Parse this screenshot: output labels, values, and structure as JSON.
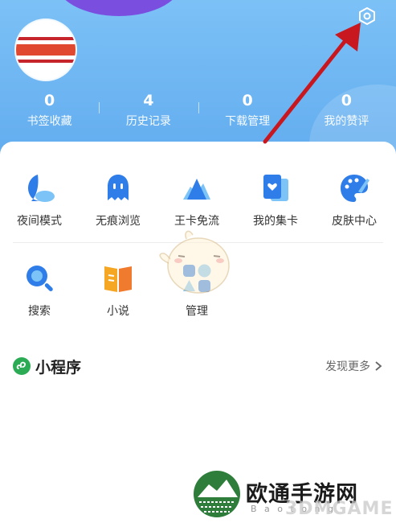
{
  "stats": [
    {
      "value": "0",
      "label": "书签收藏"
    },
    {
      "value": "4",
      "label": "历史记录"
    },
    {
      "value": "0",
      "label": "下载管理"
    },
    {
      "value": "0",
      "label": "我的赞评"
    }
  ],
  "tools_row1": [
    {
      "label": "夜间模式",
      "icon": "moon-icon"
    },
    {
      "label": "无痕浏览",
      "icon": "ghost-icon"
    },
    {
      "label": "王卡免流",
      "icon": "king-card-icon"
    },
    {
      "label": "我的集卡",
      "icon": "card-collection-icon"
    },
    {
      "label": "皮肤中心",
      "icon": "palette-icon"
    }
  ],
  "tools_row2": [
    {
      "label": "搜索",
      "icon": "search-icon"
    },
    {
      "label": "小说",
      "icon": "book-icon"
    },
    {
      "label": "管理",
      "icon": "grid-manage-icon"
    }
  ],
  "mini_program": {
    "title": "小程序",
    "more": "发现更多"
  },
  "watermark": {
    "brand": "欧通手游网",
    "sub": "B a o t o n g",
    "brand2": "3DMGAME"
  },
  "colors": {
    "header": "#6cb4f2",
    "accent_blue": "#2f7de8",
    "arrow_red": "#c8171e",
    "mini_green": "#2bab54"
  }
}
